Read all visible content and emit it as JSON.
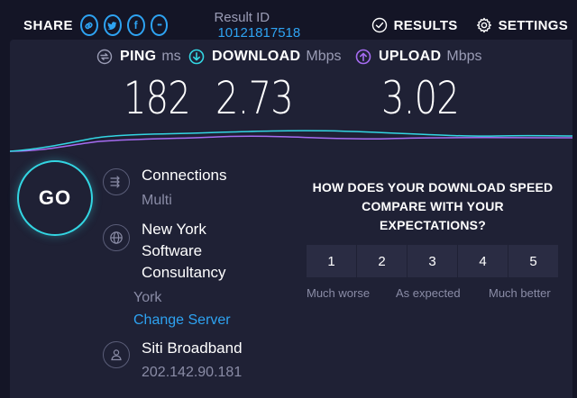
{
  "header": {
    "share_label": "SHARE",
    "share_buttons": [
      {
        "icon": "link-icon"
      },
      {
        "icon": "twitter-icon"
      },
      {
        "icon": "facebook-icon",
        "glyph": "f"
      },
      {
        "icon": "more-icon",
        "glyph": "•••"
      }
    ],
    "result_label": "Result ID",
    "result_id": "10121817518",
    "results_label": "RESULTS",
    "settings_label": "SETTINGS"
  },
  "metrics": {
    "ping": {
      "label": "PING",
      "unit": "ms",
      "value": "182"
    },
    "download": {
      "label": "DOWNLOAD",
      "unit": "Mbps",
      "value": "2.73"
    },
    "upload": {
      "label": "UPLOAD",
      "unit": "Mbps",
      "value": "3.02"
    }
  },
  "go_label": "GO",
  "server": {
    "connections_label": "Connections",
    "connections_value": "Multi",
    "host_line1": "New York",
    "host_line2": "Software",
    "host_line3": "Consultancy",
    "location": "York",
    "change_server": "Change Server",
    "isp_name": "Siti Broadband",
    "isp_ip": "202.142.90.181"
  },
  "survey": {
    "question_line1": "HOW DOES YOUR DOWNLOAD SPEED",
    "question_line2": "COMPARE WITH YOUR",
    "question_line3": "EXPECTATIONS?",
    "ratings": [
      "1",
      "2",
      "3",
      "4",
      "5"
    ],
    "low_caption": "Much worse",
    "mid_caption": "As expected",
    "high_caption": "Much better"
  },
  "colors": {
    "accent_blue": "#2ea3f2",
    "download_cyan": "#33d6e3",
    "upload_purple": "#a66cf2",
    "background": "#141526",
    "panel": "#1f2135"
  }
}
